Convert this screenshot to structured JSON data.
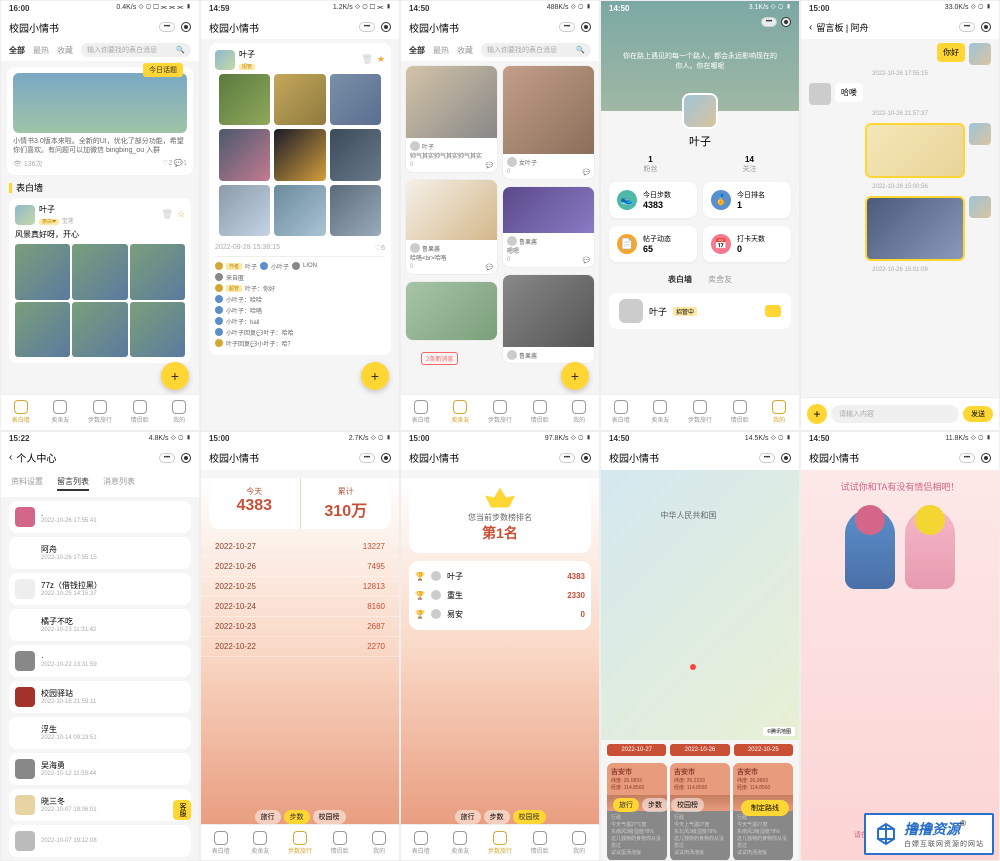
{
  "s1": {
    "time": "16:00",
    "net": "0.4K/s",
    "app": "校园小情书",
    "tabs": [
      "全部",
      "最热",
      "收藏"
    ],
    "search_placeholder": "输入你要找的表白消息",
    "topic_tag": "今日话题",
    "topic_desc": "小情书3.0版本来啦。全新的UI，优化了部分功能，希望你们喜欢。有问题可以加微信 bingbing_ou 入群",
    "topic_views": "136次",
    "section": "表白墙",
    "post": {
      "name": "叶子",
      "sub": "宝莲",
      "badge": "表白❤",
      "text": "风景真好呀，开心"
    },
    "fab": "+",
    "nav": [
      "表白墙",
      "卖舍友",
      "步数旅行",
      "情侣脸",
      "我的"
    ]
  },
  "s2": {
    "time": "14:59",
    "net": "1.2K/s",
    "app": "校园小情书",
    "user": {
      "name": "叶子",
      "badge": "招管"
    },
    "post_time": "2022-09-28 15:38:15",
    "likes": "6",
    "comments": [
      {
        "badge": "作者",
        "name": "叶子",
        "extra": "小叶子",
        "extra2": "LION"
      },
      {
        "name": "来自匿"
      },
      {
        "badge": "超管",
        "name": "叶子",
        "text": "你好"
      },
      {
        "name": "小叶子",
        "text": "哈哈"
      },
      {
        "name": "小叶子",
        "text": "哈咯"
      },
      {
        "name": "小叶子",
        "text": "hall"
      },
      {
        "name": "小叶子回复",
        "to": "叶子",
        "text": "哈哈"
      },
      {
        "name": "叶子回复",
        "to": "小叶子",
        "text": "哈？"
      }
    ],
    "fab": "+"
  },
  "s3": {
    "time": "14:50",
    "net": "488K/s",
    "app": "校园小情书",
    "tabs": [
      "全部",
      "最热",
      "收藏"
    ],
    "search_placeholder": "输入你要找的表白消息",
    "feed": [
      {
        "user": "叶子",
        "text": "帅气其实帅气其实帅气其实",
        "count": "0"
      },
      {
        "user": "女叶子",
        "count": "0"
      },
      {
        "user": "鲁果酱",
        "text": "哈咯<br>哈咯",
        "count": "0"
      },
      {
        "user": "鲁果酱",
        "sub": "嗯嗯",
        "count": "0"
      },
      {
        "user": "鲁果酱"
      }
    ],
    "chip": "2条新消息",
    "fab": "+",
    "nav": [
      "表白墙",
      "卖舍友",
      "步数旅行",
      "情侣脸",
      "我的"
    ]
  },
  "s4": {
    "time": "14:50",
    "net": "3.1K/s",
    "quote": "你在路上遇见的每一个路人，都会永远影响现在的你人。你在哪呢",
    "name": "叶子",
    "fans": "1",
    "fans_label": "粉丝",
    "follow": "14",
    "follow_label": "关注",
    "cards": [
      {
        "icon": "#4fb8a8",
        "label": "今日步数",
        "val": "4383"
      },
      {
        "icon": "#5a8fc9",
        "label": "今日排名",
        "val": "1"
      },
      {
        "icon": "#f4a633",
        "label": "帖子动态",
        "val": "65"
      },
      {
        "icon": "#f47a8f",
        "label": "打卡天数",
        "val": "0"
      }
    ],
    "mini_tabs": [
      "表白墙",
      "卖舍友"
    ],
    "friend": {
      "name": "叶子",
      "badge": "招管中"
    },
    "nav": [
      "表白墙",
      "卖舍友",
      "步数旅行",
      "情侣脸",
      "我的"
    ]
  },
  "s5": {
    "time": "15:00",
    "net": "33.0K/s",
    "title": "留言板 | 阿舟",
    "msgs": [
      {
        "side": "right",
        "text": "你好",
        "time": "2022-10-26 17:55:15"
      },
      {
        "side": "left",
        "text": "哈喽",
        "time": "2022-10-26 21:57:37"
      },
      {
        "side": "right",
        "type": "chart",
        "time": "2022-10-26 15:00:56"
      },
      {
        "side": "right",
        "type": "photo",
        "time": "2022-10-26 15:01:09"
      }
    ],
    "input_placeholder": "请输入内容",
    "send": "发送",
    "plus": "+"
  },
  "s6": {
    "time": "15:22",
    "net": "4.8K/s",
    "title": "个人中心",
    "tabs": [
      "资料设置",
      "留言列表",
      "消息列表"
    ],
    "active_idx": 1,
    "list": [
      {
        "name": ".",
        "time": "2022-10-26 17:55:41",
        "color": "#d4668a"
      },
      {
        "name": "阿舟",
        "time": "2022-10-26 17:55:15",
        "color": "#fff"
      },
      {
        "name": "77z（借钱拉黑）",
        "time": "2022-10-25 14:15:37",
        "color": "#eee"
      },
      {
        "name": "橘子不吃",
        "time": "2022-10-23 11:31:42",
        "color": "#fff"
      },
      {
        "name": "·",
        "time": "2022-10-22 13:31:59",
        "color": "#888"
      },
      {
        "name": "校园驿站",
        "time": "2022-10-18 21:59:11",
        "color": "#a3332a"
      },
      {
        "name": "浮生",
        "time": "2022-10-14 09:23:51",
        "color": "#fff"
      },
      {
        "name": "吴海勇",
        "time": "2022-10-12 11:59:44",
        "color": "#888"
      },
      {
        "name": "晓三冬",
        "time": "2022-10-07 19:06:01",
        "color": "#e8d4a3"
      },
      {
        "name": "",
        "time": "2022-10-07 19:12:08",
        "color": "#bbb"
      }
    ],
    "kefu": "客服"
  },
  "s7": {
    "time": "15:00",
    "net": "2.7K/s",
    "app": "校园小情书",
    "today_label": "今天",
    "today": "4383",
    "total_label": "累计",
    "total": "310万",
    "rows": [
      {
        "date": "2022-10-27",
        "steps": "13227"
      },
      {
        "date": "2022-10-26",
        "steps": "7495"
      },
      {
        "date": "2022-10-25",
        "steps": "12813"
      },
      {
        "date": "2022-10-24",
        "steps": "8160"
      },
      {
        "date": "2022-10-23",
        "steps": "2687"
      },
      {
        "date": "2022-10-22",
        "steps": "2270"
      }
    ],
    "btm": [
      "旅行",
      "步数",
      "校园榜"
    ],
    "nav": [
      "表白墙",
      "卖舍友",
      "步数旅行",
      "情侣脸",
      "我的"
    ]
  },
  "s8": {
    "time": "15:00",
    "net": "97.8K/s",
    "app": "校园小情书",
    "rank_text": "您当前步数榜排名",
    "rank": "第1名",
    "items": [
      {
        "name": "叶子",
        "val": "4383"
      },
      {
        "name": "重生",
        "val": "2330"
      },
      {
        "name": "易安",
        "val": "0"
      }
    ],
    "btm": [
      "旅行",
      "步数",
      "校园榜"
    ],
    "nav": [
      "表白墙",
      "卖舍友",
      "步数旅行",
      "情侣脸",
      "我的"
    ]
  },
  "s9": {
    "time": "14:50",
    "net": "14.5K/s",
    "app": "校园小情书",
    "country": "中华人民共和国",
    "attr": "腾讯地图",
    "dates": [
      "2022-10-27",
      "2022-10-26",
      "2022-10-25"
    ],
    "cards": [
      {
        "city": "吉安市",
        "lat": "26.0893",
        "lng": "114.8560",
        "label": "行政",
        "temp": "今天气温27℃度",
        "wind": "东南风3级湿度78%",
        "note": "这儿独特的食物你从没尝过",
        "extra": "试试蛋汤泡饭"
      },
      {
        "city": "吉安市",
        "lat": "26.2233",
        "lng": "114.8560",
        "label": "行政",
        "temp": "今天上气温27度",
        "wind": "东北风3级湿度78%",
        "note": "这儿独特的食物你从没尝过",
        "extra": "试试肉汤泡饭"
      },
      {
        "city": "吉安市",
        "lat": "26.0893",
        "lng": "114.8560",
        "label": "行政",
        "temp": "今天气温27度",
        "wind": "东南风3级湿度78%",
        "note": "这儿独特的食物你从没尝过",
        "extra": "试试肉汤泡饭"
      }
    ],
    "btm": [
      "旅行",
      "步数",
      "校园榜"
    ],
    "set": "制定路线"
  },
  "s10": {
    "time": "14:50",
    "net": "11.8K/s",
    "app": "校园小情书",
    "title": "试试你和TA有没有情侣相吧！",
    "foot": "请在上方上传你和TA的头像吧"
  },
  "logo": {
    "text": "撸撸资源",
    "sub": "白嫖互联网资源的网站",
    "reg": "®"
  }
}
